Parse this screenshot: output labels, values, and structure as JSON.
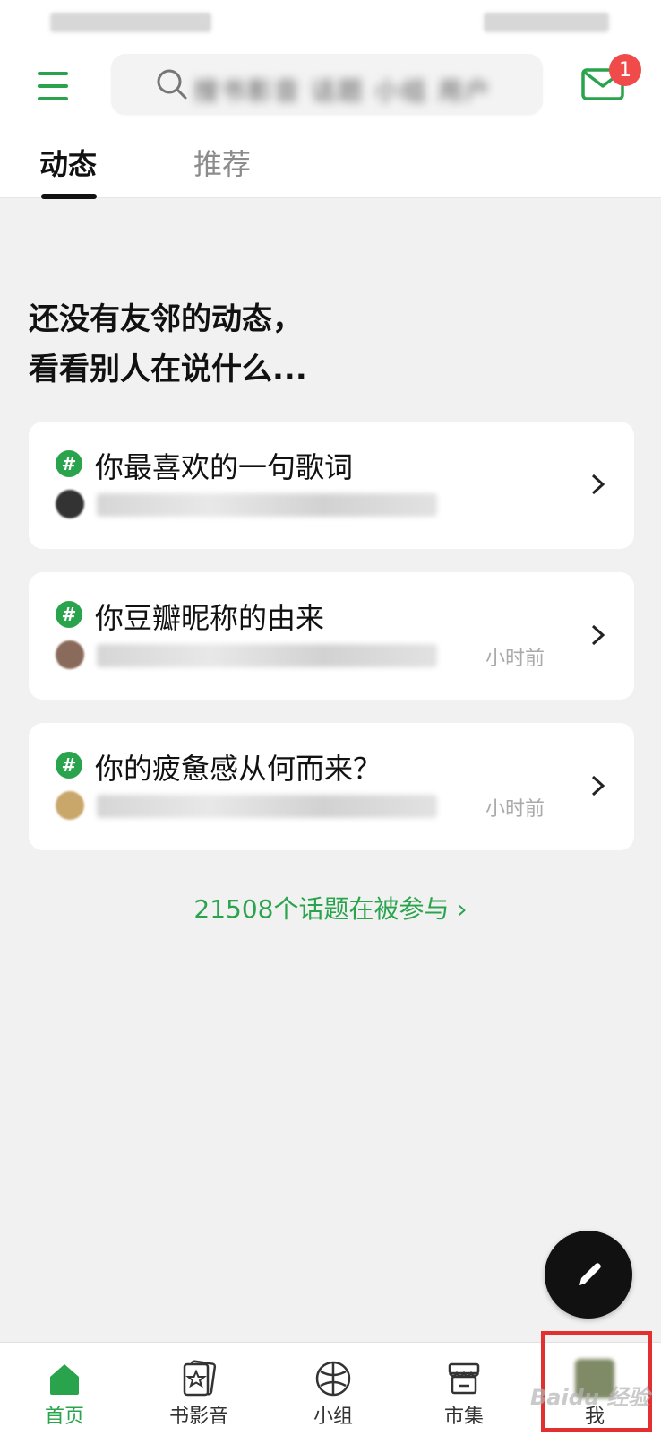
{
  "header": {
    "search_placeholder": "搜书影音 话题 小组 用户",
    "mail_badge": "1"
  },
  "tabs": [
    {
      "label": "动态"
    },
    {
      "label": "推荐"
    }
  ],
  "empty": {
    "line1": "还没有友邻的动态，",
    "line2": "看看别人在说什么..."
  },
  "topics": [
    {
      "title": "你最喜欢的一句歌词",
      "time": ""
    },
    {
      "title": "你豆瓣昵称的由来",
      "time": "小时前"
    },
    {
      "title": "你的疲惫感从何而来？",
      "time": "小时前"
    }
  ],
  "topics_link": "21508个话题在被参与 ›",
  "bottom_nav": [
    {
      "label": "首页",
      "icon": "home-icon"
    },
    {
      "label": "书影音",
      "icon": "cards-icon"
    },
    {
      "label": "小组",
      "icon": "ball-icon"
    },
    {
      "label": "市集",
      "icon": "store-icon"
    },
    {
      "label": "我",
      "icon": "avatar"
    }
  ],
  "colors": {
    "accent": "#2aa44c",
    "badge": "#f04a4a"
  },
  "watermark": "Baidu 经验"
}
